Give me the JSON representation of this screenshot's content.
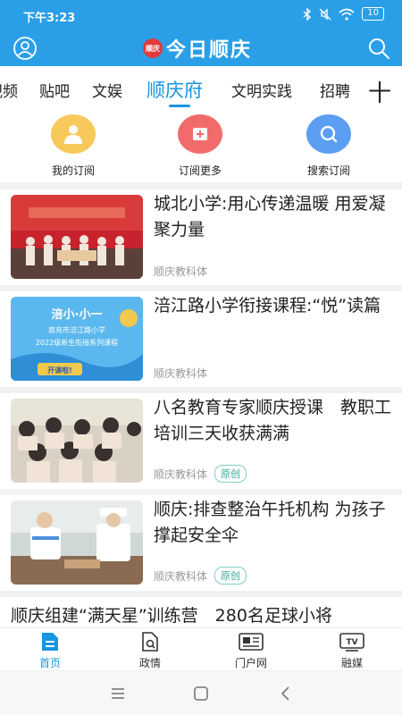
{
  "status": {
    "time": "下午3:23",
    "battery": "10"
  },
  "header": {
    "logo_seal": "顺庆",
    "title": "今日顺庆"
  },
  "tabs": [
    {
      "label": "视频"
    },
    {
      "label": "贴吧"
    },
    {
      "label": "文娱"
    },
    {
      "label": "顺庆府"
    },
    {
      "label": "文明实践"
    },
    {
      "label": "招聘"
    }
  ],
  "tab_add": "十",
  "subscriptions": [
    {
      "label": "我的订阅"
    },
    {
      "label": "订阅更多"
    },
    {
      "label": "搜索订阅"
    }
  ],
  "news": [
    {
      "title": "城北小学:用心传递温暖 用爱凝聚力量",
      "source": "顺庆教科体",
      "badge": ""
    },
    {
      "title": "涪江路小学衔接课程:“悦”读篇",
      "source": "顺庆教科体",
      "badge": ""
    },
    {
      "title": "八名教育专家顺庆授课　教职工培训三天收获满满",
      "source": "顺庆教科体",
      "badge": "原创"
    },
    {
      "title": "顺庆:排查整治午托机构 为孩子撑起安全伞",
      "source": "顺庆教科体",
      "badge": "原创"
    }
  ],
  "partial_news": {
    "title": "顺庆组建“满天星”训练营　280名足球小将"
  },
  "thumb_texts": {
    "thumb2_line1": "涪小·小一",
    "thumb2_line2": "南充市涪江路小学",
    "thumb2_line3": "2022级新生衔接系列课程",
    "thumb2_line4": "开课啦!"
  },
  "bottom_nav": [
    {
      "label": "首页"
    },
    {
      "label": "政情"
    },
    {
      "label": "门户网"
    },
    {
      "label": "融媒"
    }
  ],
  "colors": {
    "brand": "#2a9fe8",
    "accent": "#1a95e0",
    "badge": "#35a89a"
  }
}
